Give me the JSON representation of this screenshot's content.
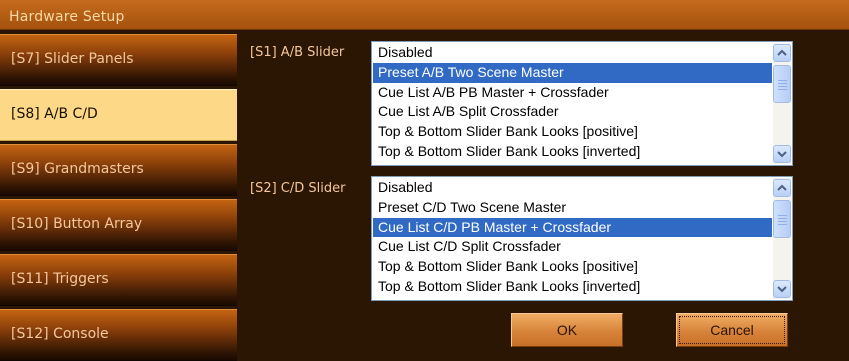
{
  "window": {
    "title": "Hardware Setup"
  },
  "sidebar": {
    "items": [
      {
        "label": "[S7] Slider Panels",
        "active": false
      },
      {
        "label": "[S8] A/B C/D",
        "active": true
      },
      {
        "label": "[S9] Grandmasters",
        "active": false
      },
      {
        "label": "[S10] Button Array",
        "active": false
      },
      {
        "label": "[S11] Triggers",
        "active": false
      },
      {
        "label": "[S12] Console",
        "active": false
      }
    ]
  },
  "ab_slider": {
    "label": "[S1] A/B Slider",
    "options": [
      "Disabled",
      "Preset A/B Two Scene Master",
      "Cue List A/B PB Master + Crossfader",
      "Cue List A/B Split Crossfader",
      "Top & Bottom Slider Bank Looks [positive]",
      "Top & Bottom Slider Bank Looks [inverted]"
    ],
    "selected": "Preset A/B Two Scene Master"
  },
  "cd_slider": {
    "label": "[S2] C/D Slider",
    "options": [
      "Disabled",
      "Preset C/D Two Scene Master",
      "Cue List C/D PB Master + Crossfader",
      "Cue List C/D Split Crossfader",
      "Top & Bottom Slider Bank Looks [positive]",
      "Top & Bottom Slider Bank Looks [inverted]"
    ],
    "selected": "Cue List C/D PB Master + Crossfader"
  },
  "buttons": {
    "ok": "OK",
    "cancel": "Cancel"
  },
  "colors": {
    "background": "#2b1503",
    "titlebar": "#b85f15",
    "accent_orange": "#d7843a",
    "active_tab": "#fdd987",
    "selection": "#316ac5",
    "label_text": "#f4c79d"
  }
}
